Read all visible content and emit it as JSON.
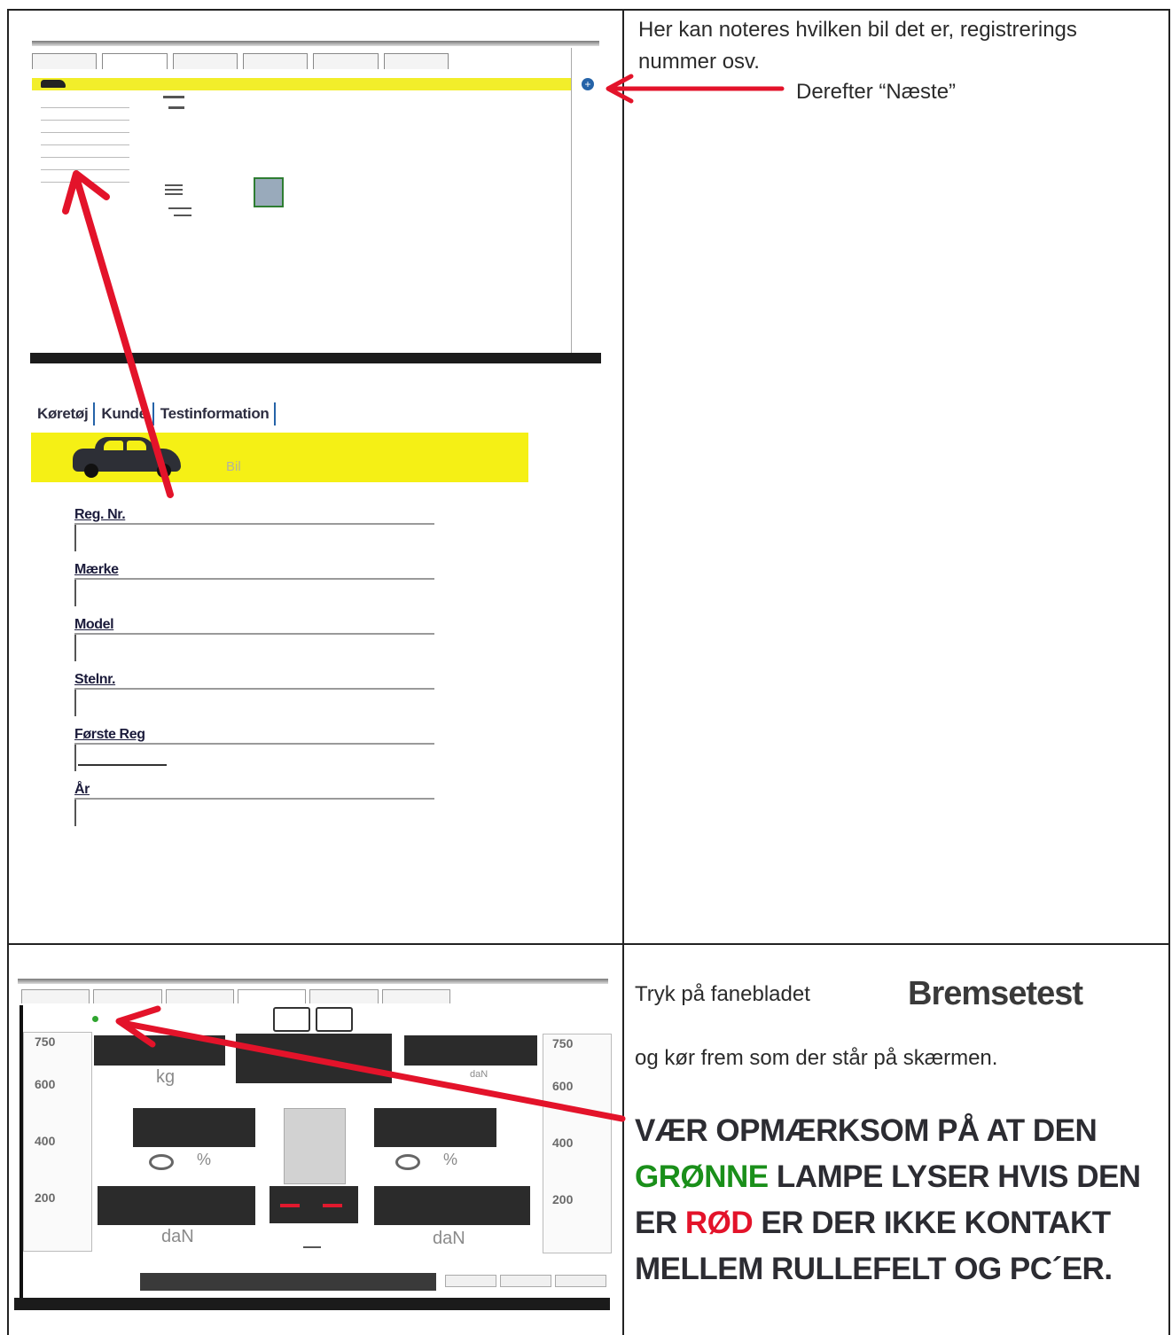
{
  "top_note": {
    "line1": "Her kan noteres hvilken bil det er, registrerings",
    "line2": "nummer osv.",
    "next_label": "Derefter “Næste”"
  },
  "vehicle_form": {
    "tabs": [
      "Køretøj",
      "Kunde",
      "Testinformation"
    ],
    "banner_label": "Bil",
    "fields": [
      "Reg. Nr.",
      "Mærke",
      "Model",
      "Stelnr.",
      "Første Reg",
      "År"
    ]
  },
  "brake_note": {
    "line1": "Tryk på fanebladet",
    "tab_name": "Bremsetest",
    "line2": "og kør frem som der står på skærmen."
  },
  "warning": {
    "part1": "VÆR OPMÆRKSOM PÅ AT DEN",
    "green_word": "GRØNNE",
    "part2": " LAMPE LYSER HVIS DEN",
    "part3": "ER ",
    "red_word": "RØD",
    "part4": " ER DER IKKE KONTAKT",
    "part5": "MELLEM RULLEFELT OG PC´ER."
  },
  "brake_screen": {
    "scale_left": [
      "750",
      "600",
      "400",
      "200"
    ],
    "scale_right": [
      "750",
      "600",
      "400",
      "200"
    ],
    "unit_kg": "kg",
    "unit_dan_left": "daN",
    "unit_dan_right": "daN",
    "unit_dan_small": "daN",
    "pct_left": "%",
    "pct_right": "%"
  },
  "colors": {
    "banner_yellow": "#f5f015",
    "arrow_red": "#e3132a",
    "lamp_green": "#2fa52f"
  }
}
